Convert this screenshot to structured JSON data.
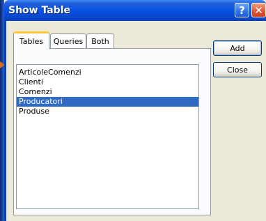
{
  "window": {
    "title": "Show Table",
    "help_glyph": "?",
    "close_glyph": "✕"
  },
  "tabs": [
    {
      "label": "Tables",
      "active": true
    },
    {
      "label": "Queries",
      "active": false
    },
    {
      "label": "Both",
      "active": false
    }
  ],
  "list": {
    "items": [
      {
        "label": "ArticoleComenzi",
        "selected": false
      },
      {
        "label": "Clienti",
        "selected": false
      },
      {
        "label": "Comenzi",
        "selected": false
      },
      {
        "label": "Producatori",
        "selected": true
      },
      {
        "label": "Produse",
        "selected": false
      }
    ]
  },
  "buttons": {
    "add_label": "Add",
    "close_label": "Close"
  },
  "colors": {
    "titlebar": "#0A54E3",
    "selection": "#316AC5",
    "dialog_bg": "#ECE9D8",
    "arrow": "#D2691E"
  }
}
